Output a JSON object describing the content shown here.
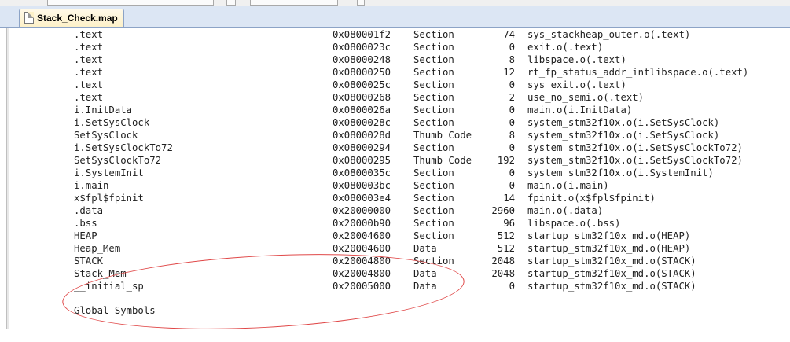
{
  "tab": {
    "title": "Stack_Check.map"
  },
  "rows": [
    {
      "name": ".text",
      "addr": "0x080001f2",
      "type": "Section",
      "size": "74",
      "obj": "sys_stackheap_outer.o(.text)"
    },
    {
      "name": ".text",
      "addr": "0x0800023c",
      "type": "Section",
      "size": "0",
      "obj": "exit.o(.text)"
    },
    {
      "name": ".text",
      "addr": "0x08000248",
      "type": "Section",
      "size": "8",
      "obj": "libspace.o(.text)"
    },
    {
      "name": ".text",
      "addr": "0x08000250",
      "type": "Section",
      "size": "12",
      "obj": "rt_fp_status_addr_intlibspace.o(.text)"
    },
    {
      "name": ".text",
      "addr": "0x0800025c",
      "type": "Section",
      "size": "0",
      "obj": "sys_exit.o(.text)"
    },
    {
      "name": ".text",
      "addr": "0x08000268",
      "type": "Section",
      "size": "2",
      "obj": "use_no_semi.o(.text)"
    },
    {
      "name": "i.InitData",
      "addr": "0x0800026a",
      "type": "Section",
      "size": "0",
      "obj": "main.o(i.InitData)"
    },
    {
      "name": "i.SetSysClock",
      "addr": "0x0800028c",
      "type": "Section",
      "size": "0",
      "obj": "system_stm32f10x.o(i.SetSysClock)"
    },
    {
      "name": "SetSysClock",
      "addr": "0x0800028d",
      "type": "Thumb Code",
      "size": "8",
      "obj": "system_stm32f10x.o(i.SetSysClock)"
    },
    {
      "name": "i.SetSysClockTo72",
      "addr": "0x08000294",
      "type": "Section",
      "size": "0",
      "obj": "system_stm32f10x.o(i.SetSysClockTo72)"
    },
    {
      "name": "SetSysClockTo72",
      "addr": "0x08000295",
      "type": "Thumb Code",
      "size": "192",
      "obj": "system_stm32f10x.o(i.SetSysClockTo72)"
    },
    {
      "name": "i.SystemInit",
      "addr": "0x0800035c",
      "type": "Section",
      "size": "0",
      "obj": "system_stm32f10x.o(i.SystemInit)"
    },
    {
      "name": "i.main",
      "addr": "0x080003bc",
      "type": "Section",
      "size": "0",
      "obj": "main.o(i.main)"
    },
    {
      "name": "x$fpl$fpinit",
      "addr": "0x080003e4",
      "type": "Section",
      "size": "14",
      "obj": "fpinit.o(x$fpl$fpinit)"
    },
    {
      "name": ".data",
      "addr": "0x20000000",
      "type": "Section",
      "size": "2960",
      "obj": "main.o(.data)"
    },
    {
      "name": ".bss",
      "addr": "0x20000b90",
      "type": "Section",
      "size": "96",
      "obj": "libspace.o(.bss)"
    },
    {
      "name": "HEAP",
      "addr": "0x20004600",
      "type": "Section",
      "size": "512",
      "obj": "startup_stm32f10x_md.o(HEAP)"
    },
    {
      "name": "Heap_Mem",
      "addr": "0x20004600",
      "type": "Data",
      "size": "512",
      "obj": "startup_stm32f10x_md.o(HEAP)"
    },
    {
      "name": "STACK",
      "addr": "0x20004800",
      "type": "Section",
      "size": "2048",
      "obj": "startup_stm32f10x_md.o(STACK)"
    },
    {
      "name": "Stack_Mem",
      "addr": "0x20004800",
      "type": "Data",
      "size": "2048",
      "obj": "startup_stm32f10x_md.o(STACK)"
    },
    {
      "name": "__initial_sp",
      "addr": "0x20005000",
      "type": "Data",
      "size": "0",
      "obj": "startup_stm32f10x_md.o(STACK)"
    }
  ],
  "footer": {
    "heading": "Global Symbols"
  },
  "colors": {
    "annotation": "#e04848",
    "tab_bg": "#fdf1c9",
    "tabbar_bg": "#dce6f4"
  }
}
